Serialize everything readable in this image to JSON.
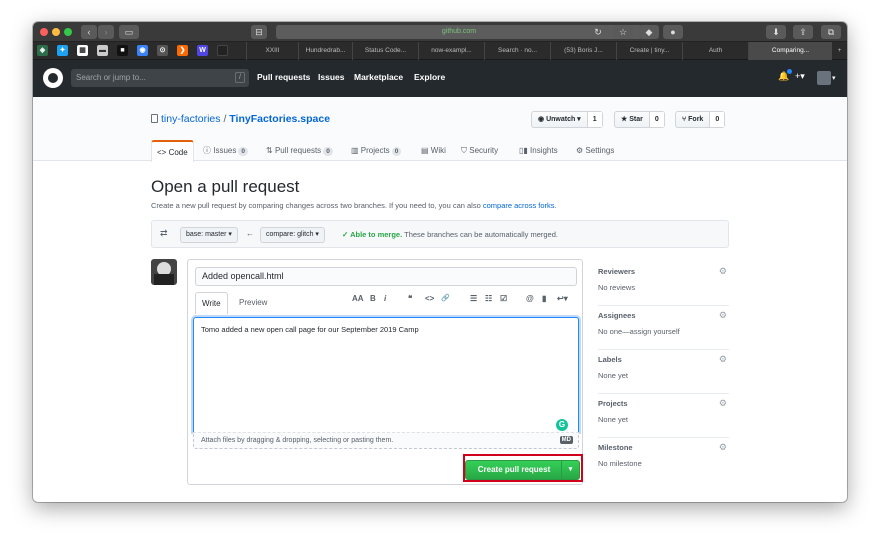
{
  "browser": {
    "address": "github.com",
    "tabs": [
      "XXIII",
      "Hundredrab...",
      "Status Code...",
      "now-exampl...",
      "Search · no...",
      "(53) Boris J...",
      "Create | tiny...",
      "Auth",
      "Comparing..."
    ],
    "new_tab_label": "+"
  },
  "header": {
    "search_placeholder": "Search or jump to...",
    "search_shortcut": "/",
    "nav": [
      "Pull requests",
      "Issues",
      "Marketplace",
      "Explore"
    ],
    "plus_label": "+▾"
  },
  "repo": {
    "owner": "tiny-factories",
    "separator": " / ",
    "name": "TinyFactories.space",
    "watch_label": "Unwatch ▾",
    "watch_count": "1",
    "star_label": "Star",
    "star_count": "0",
    "fork_label": "Fork",
    "fork_count": "0",
    "tabs": [
      {
        "label": "Code",
        "count": null
      },
      {
        "label": "Issues",
        "count": "0"
      },
      {
        "label": "Pull requests",
        "count": "0"
      },
      {
        "label": "Projects",
        "count": "0"
      },
      {
        "label": "Wiki",
        "count": null
      },
      {
        "label": "Security",
        "count": null
      },
      {
        "label": "Insights",
        "count": null
      },
      {
        "label": "Settings",
        "count": null
      }
    ]
  },
  "page": {
    "title": "Open a pull request",
    "subtitle_prefix": "Create a new pull request by comparing changes across two branches. If you need to, you can also ",
    "subtitle_link": "compare across forks",
    "subtitle_suffix": ".",
    "base_label": "base: master ▾",
    "arrow": "←",
    "compare_label": "compare: glitch ▾",
    "merge_status": "✓ Able to merge.",
    "merge_detail": " These branches can be automatically merged."
  },
  "form": {
    "title_value": "Added opencall.html",
    "write_tab": "Write",
    "preview_tab": "Preview",
    "toolbar_icons": [
      "AA",
      "B",
      "i",
      "❝",
      "<>",
      "🔗",
      "☰",
      "☷",
      "☑",
      "@",
      "▮",
      "↩▾"
    ],
    "body": "Tomo added a new open call page for our September 2019 Camp",
    "attach_text": "Attach files by dragging & dropping, selecting or pasting them.",
    "md_badge": "MD",
    "create_button": "Create pull request",
    "caret": "▾"
  },
  "sidebar": [
    {
      "title": "Reviewers",
      "value": "No reviews"
    },
    {
      "title": "Assignees",
      "value": "No one—assign yourself"
    },
    {
      "title": "Labels",
      "value": "None yet"
    },
    {
      "title": "Projects",
      "value": "None yet"
    },
    {
      "title": "Milestone",
      "value": "No milestone"
    }
  ]
}
